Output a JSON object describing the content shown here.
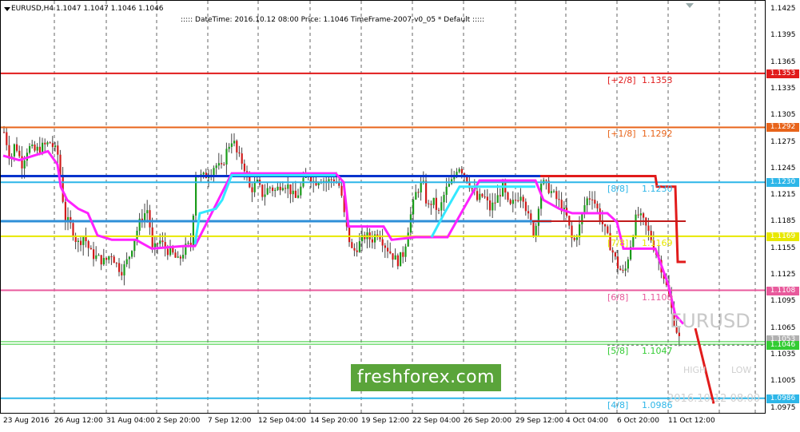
{
  "header": {
    "symbol_line": "EURUSD,H4  1.1047 1.1047 1.1046 1.1046",
    "info_line": ":::::  DateTime: 2016.10.12 08:00   Price: 1.1046   TimeFrame-2007-v0_05    *   Default   :::::"
  },
  "watermark": "freshforex.com",
  "symbol_big": "EURUSD",
  "high_label": "HIGH",
  "low_label": "LOW",
  "datetime_label": "2016.10.12 08:00",
  "y_axis": [
    "1.1425",
    "1.1395",
    "1.1365",
    "1.1335",
    "1.1305",
    "1.1275",
    "1.1245",
    "1.1215",
    "1.1185",
    "1.1155",
    "1.1125",
    "1.1095",
    "1.1065",
    "1.1035",
    "1.1005",
    "1.0975"
  ],
  "x_axis": [
    "23 Aug 2016",
    "26 Aug 12:00",
    "31 Aug 04:00",
    "2 Sep 20:00",
    "7 Sep 12:00",
    "12 Sep 04:00",
    "14 Sep 20:00",
    "19 Sep 12:00",
    "22 Sep 04:00",
    "26 Sep 20:00",
    "29 Sep 12:00",
    "4 Oct 04:00",
    "6 Oct 20:00",
    "11 Oct 12:00"
  ],
  "levels": [
    {
      "label": "[+2/8]",
      "value": "1.1353",
      "color": "#e11b1b"
    },
    {
      "label": "[+1/8]",
      "value": "1.1292",
      "color": "#e8641a"
    },
    {
      "label": "[8/8]",
      "value": "1.1230",
      "color": "#2db6e8"
    },
    {
      "label": "[7/8]",
      "value": "1.1169",
      "color": "#e8e800"
    },
    {
      "label": "[6/8]",
      "value": "1.1108",
      "color": "#e85a9c"
    },
    {
      "label": "[5/8]",
      "value": "1.1047",
      "color": "#33cc33"
    },
    {
      "label": "[4/8]",
      "value": "1.0986",
      "color": "#2db6e8"
    }
  ],
  "price_tags": [
    {
      "value": "1.1353",
      "color": "#e11b1b"
    },
    {
      "value": "1.1292",
      "color": "#e8641a"
    },
    {
      "value": "1.1230",
      "color": "#2db6e8"
    },
    {
      "value": "1.1169",
      "color": "#e8e800"
    },
    {
      "value": "1.1108",
      "color": "#e85a9c"
    },
    {
      "value": "1.1053",
      "color": "#b0b0b0"
    },
    {
      "value": "1.1046",
      "color": "#33cc33"
    },
    {
      "value": "1.0986",
      "color": "#2db6e8"
    }
  ],
  "colors": {
    "bull": "#1b9c1b",
    "bear": "#d11b1b",
    "wick": "#444444",
    "magenta": "#ff22ff",
    "cyan": "#33e8ff",
    "navy": "#0033cc",
    "grid": "#000000"
  }
}
